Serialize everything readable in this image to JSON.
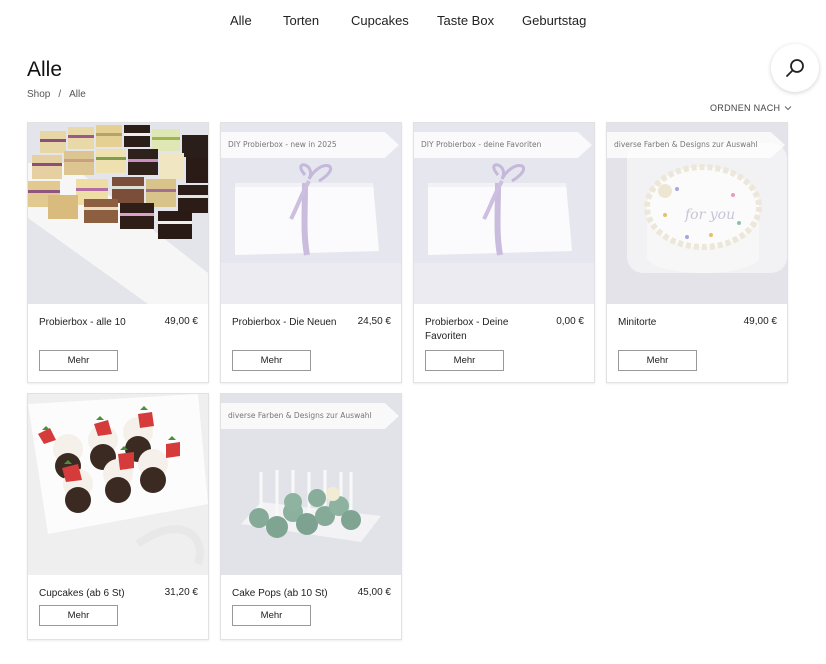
{
  "nav": {
    "items": [
      "Alle",
      "Torten",
      "Cupcakes",
      "Taste Box",
      "Geburtstag"
    ]
  },
  "page": {
    "title": "Alle",
    "breadcrumb": [
      "Shop",
      "/",
      "Alle"
    ],
    "sort_label": "ORDNEN NACH"
  },
  "search": {
    "icon": "search-icon"
  },
  "products": [
    {
      "name": "Probierbox - alle 10",
      "price": "49,00 €",
      "button": "Mehr",
      "banner": ""
    },
    {
      "name": "Probierbox - Die Neuen",
      "price": "24,50 €",
      "button": "Mehr",
      "banner": "DIY Probierbox - new in 2025"
    },
    {
      "name": "Probierbox - Deine Favoriten",
      "price": "0,00 €",
      "button": "Mehr",
      "banner": "DIY Probierbox - deine Favoriten"
    },
    {
      "name": "Minitorte",
      "price": "49,00 €",
      "button": "Mehr",
      "banner": "diverse Farben & Designs zur Auswahl"
    },
    {
      "name": "Cupcakes (ab 6 St)",
      "price": "31,20 €",
      "button": "Mehr",
      "banner": ""
    },
    {
      "name": "Cake Pops (ab 10 St)",
      "price": "45,00 €",
      "button": "Mehr",
      "banner": "diverse Farben & Designs zur Auswahl"
    }
  ],
  "colors": {
    "text": "#222222",
    "border": "#e2e2e2",
    "accent": "#111111"
  }
}
